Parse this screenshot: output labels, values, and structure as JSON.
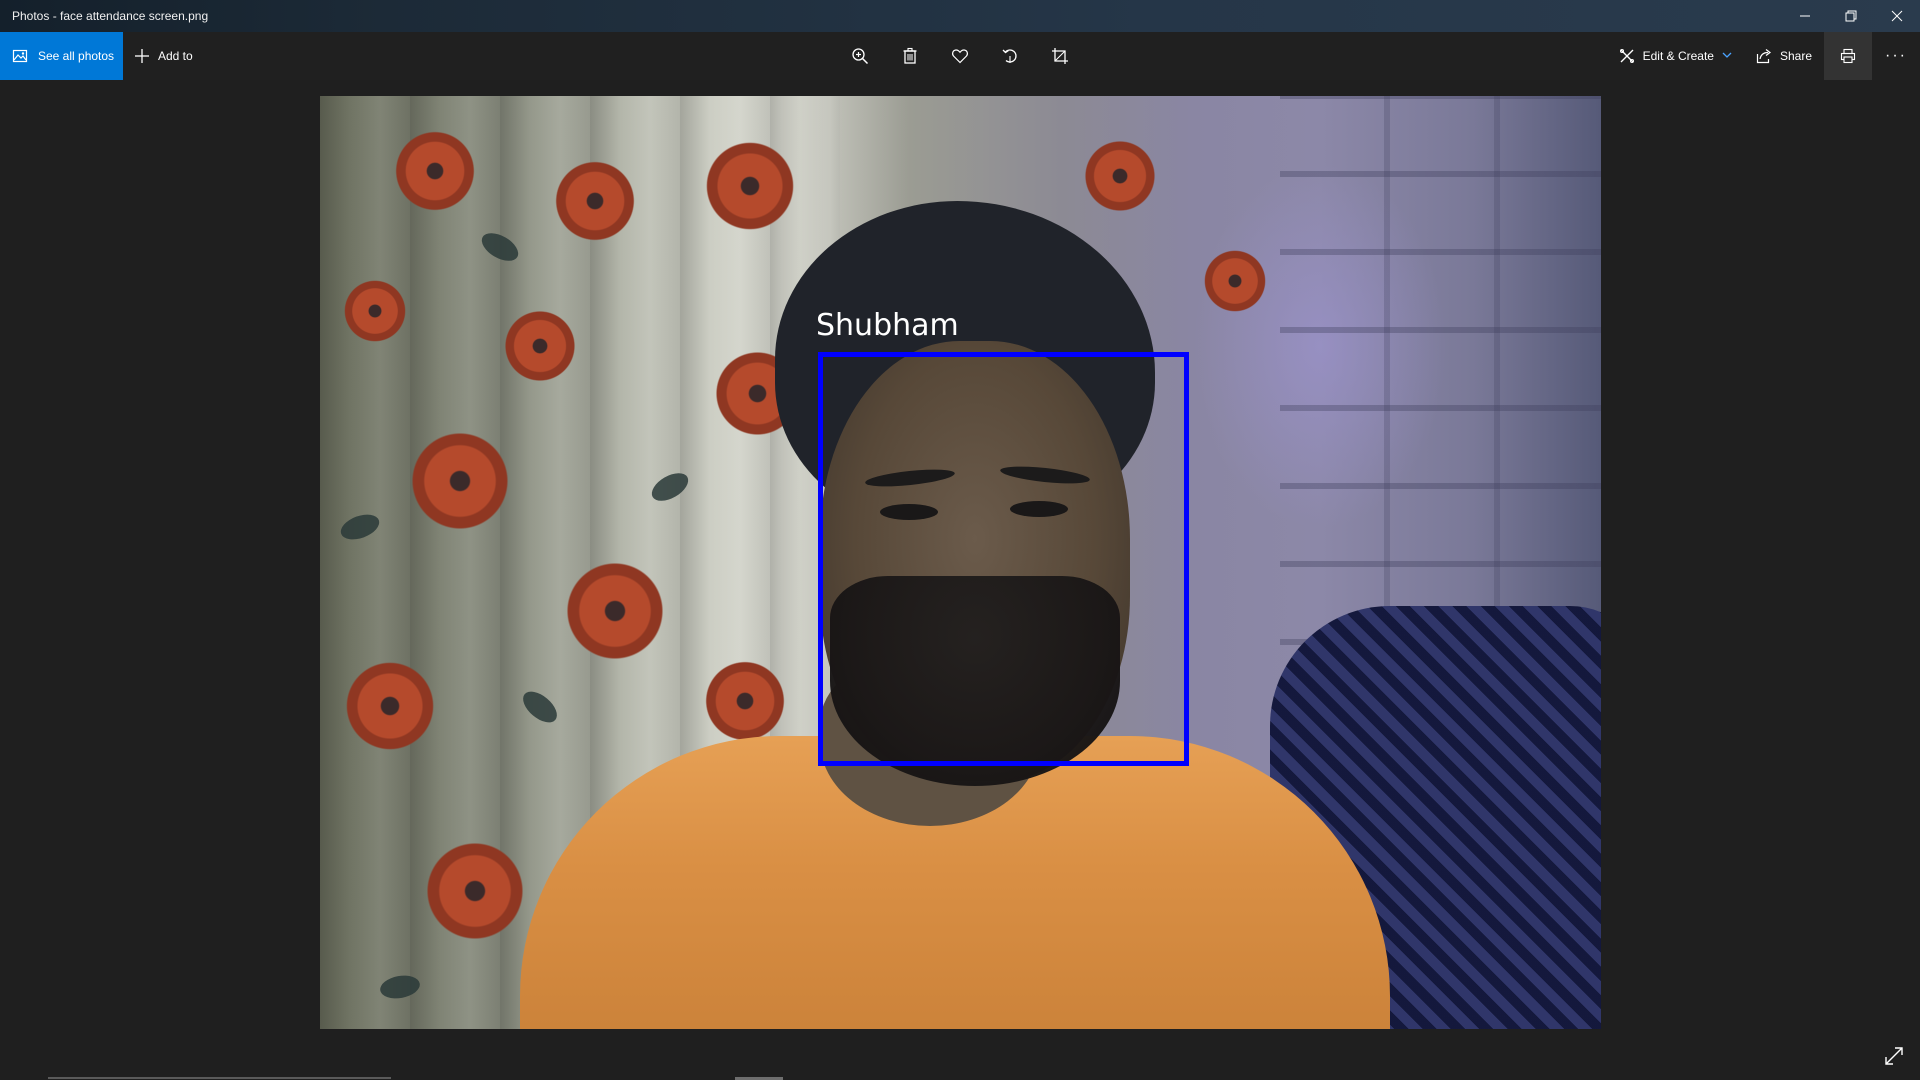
{
  "window": {
    "title": "Photos - face attendance screen.png",
    "controls": [
      "minimize-icon",
      "restore-icon",
      "close-icon"
    ]
  },
  "toolbar": {
    "see_all_label": "See all photos",
    "add_to_label": "Add to",
    "center_tools": [
      "zoom-in-icon",
      "delete-icon",
      "favorite-icon",
      "rotate-icon",
      "crop-icon"
    ],
    "edit_create_label": "Edit & Create",
    "share_label": "Share",
    "more_label": "···"
  },
  "photo": {
    "detected_name": "Shubham",
    "box_color": "#0000ff"
  },
  "colors": {
    "accent": "#0078d7",
    "titlebar": "#1c2a37",
    "background": "#1f1f1f"
  }
}
